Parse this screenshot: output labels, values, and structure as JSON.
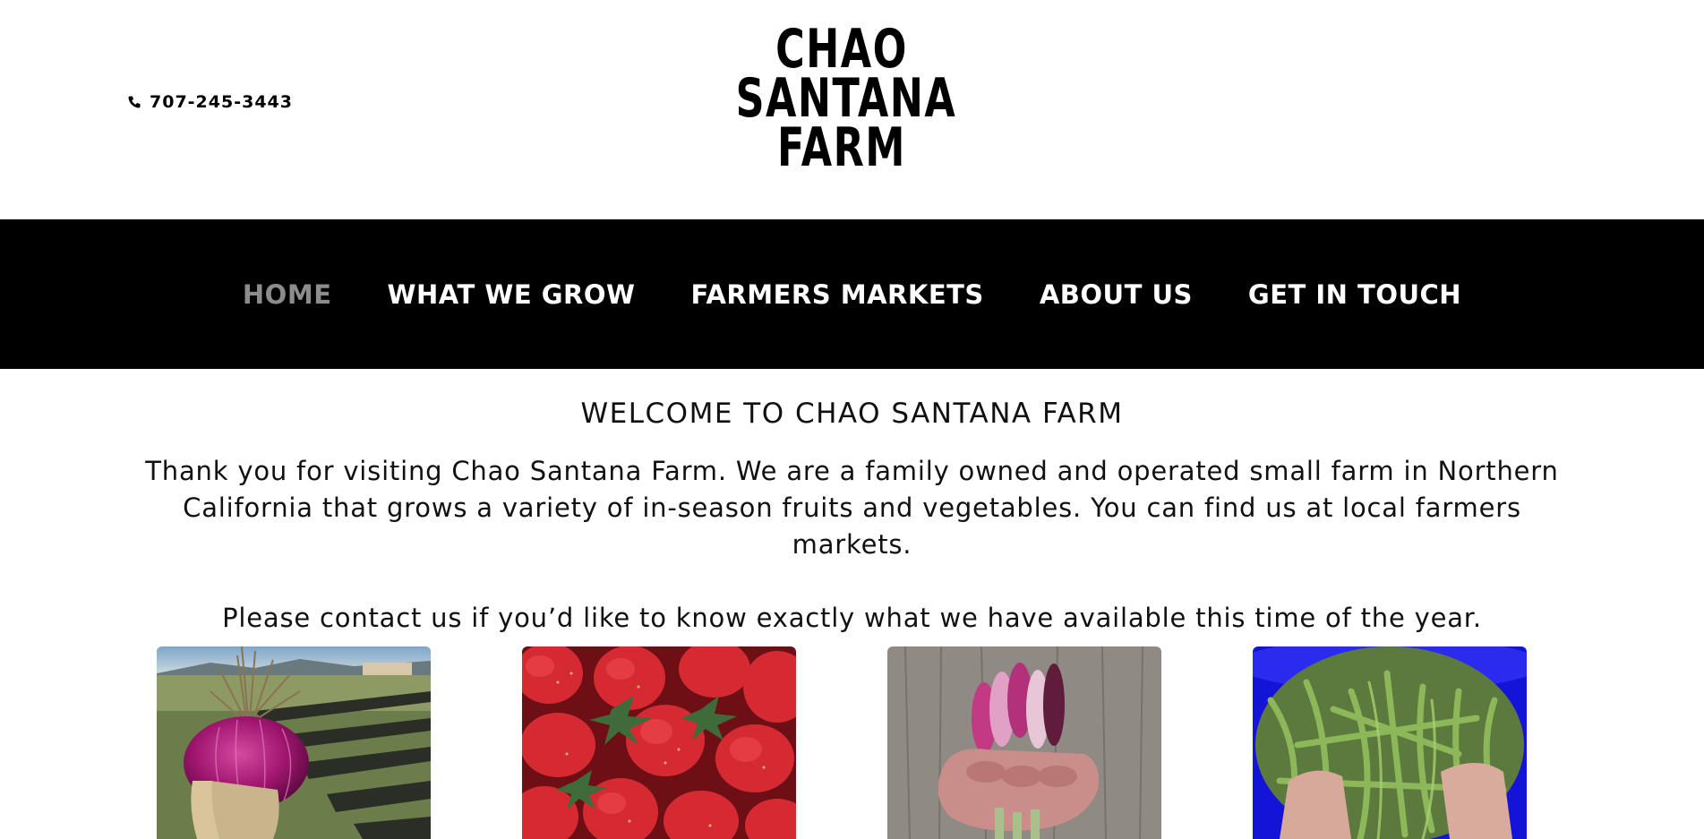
{
  "header": {
    "phone_icon": "phone-icon",
    "phone": "707-245-3443",
    "logo_lines": [
      "CHAO",
      "SANTANA",
      "FARM"
    ]
  },
  "nav": {
    "items": [
      {
        "label": "HOME",
        "active": true
      },
      {
        "label": "WHAT WE GROW",
        "active": false
      },
      {
        "label": "FARMERS MARKETS",
        "active": false
      },
      {
        "label": "ABOUT US",
        "active": false
      },
      {
        "label": "GET IN TOUCH",
        "active": false
      }
    ]
  },
  "main": {
    "heading": "WELCOME TO CHAO SANTANA FARM",
    "intro_line1": "Thank you for visiting Chao Santana Farm. We are a family owned and operated small farm in Northern",
    "intro_line2": "California that grows a variety of in-season fruits and vegetables. You can find us at local farmers markets.",
    "contact": "Please contact us if you’d like to know exactly what we have available this time of the year."
  },
  "gallery": {
    "images": [
      {
        "name": "red-onion-photo"
      },
      {
        "name": "strawberries-photo"
      },
      {
        "name": "spring-onions-photo"
      },
      {
        "name": "green-beans-photo"
      }
    ]
  },
  "colors": {
    "nav_background": "#000000",
    "nav_text": "#ffffff",
    "nav_active": "#8c8c8c"
  }
}
